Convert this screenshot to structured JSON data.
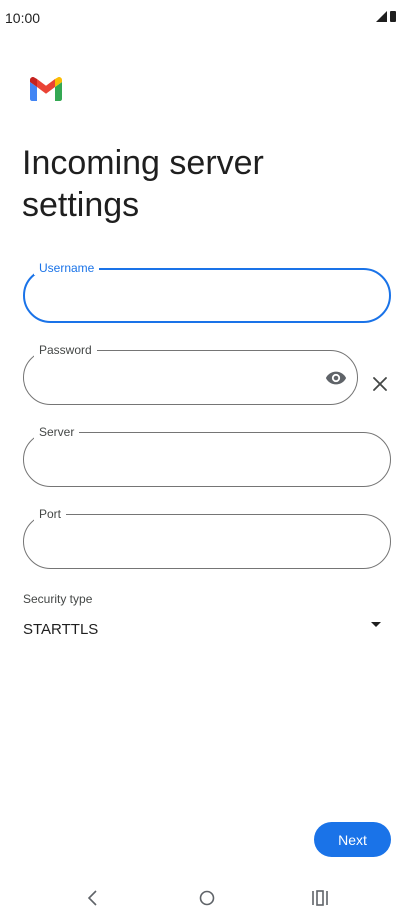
{
  "status_bar": {
    "time": "10:00",
    "icons": [
      "signal-icon",
      "battery-icon"
    ]
  },
  "app": {
    "logo": "gmail-logo",
    "title": "Incoming server settings"
  },
  "form": {
    "username": {
      "label": "Username",
      "value": "",
      "state": "focused"
    },
    "password": {
      "label": "Password",
      "value": "",
      "trailing_icon": "eye-icon",
      "outer_icon": "close-icon"
    },
    "server": {
      "label": "Server",
      "value": ""
    },
    "port": {
      "label": "Port",
      "value": ""
    },
    "security_type": {
      "label": "Security type",
      "selected": "STARTTLS"
    }
  },
  "actions": {
    "next_label": "Next"
  },
  "nav": {
    "buttons": [
      "back-icon",
      "home-icon",
      "recents-icon"
    ]
  },
  "colors": {
    "accent": "#1a73e8",
    "outline": "#757575",
    "text": "#1f1f1f",
    "secondary_text": "#444746",
    "background": "#ffffff"
  }
}
